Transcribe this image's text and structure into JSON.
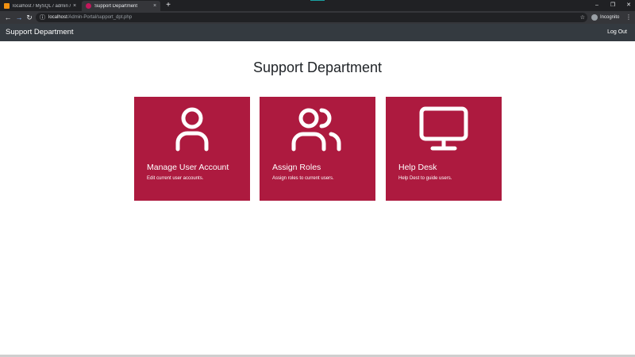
{
  "browser": {
    "tabs": [
      {
        "title": "localhost / MySQL / admin / use",
        "close": "×"
      },
      {
        "title": "Support Department",
        "close": "×"
      }
    ],
    "new_tab": "+",
    "window_controls": {
      "minimize": "–",
      "maximize": "❐",
      "close": "✕"
    },
    "nav": {
      "back": "←",
      "forward": "→",
      "reload": "↻"
    },
    "address": {
      "host": "localhost",
      "path": "/Admin-Portal/support_dpt.php",
      "info_icon": "ⓘ",
      "star": "☆"
    },
    "profile_label": "Incognito",
    "menu": "⋮"
  },
  "navbar": {
    "brand": "Support Department",
    "logout": "Log Out"
  },
  "page": {
    "title": "Support Department",
    "cards": [
      {
        "icon": "user-icon",
        "title": "Manage User Account",
        "desc": "Edit current user accounts."
      },
      {
        "icon": "users-icon",
        "title": "Assign Roles",
        "desc": "Assign roles to current users."
      },
      {
        "icon": "monitor-icon",
        "title": "Help Desk",
        "desc": "Help Dest to guide users."
      }
    ]
  },
  "colors": {
    "card_bg": "#ad1a3f",
    "navbar_bg": "#343a40",
    "browser_bg": "#202124"
  }
}
